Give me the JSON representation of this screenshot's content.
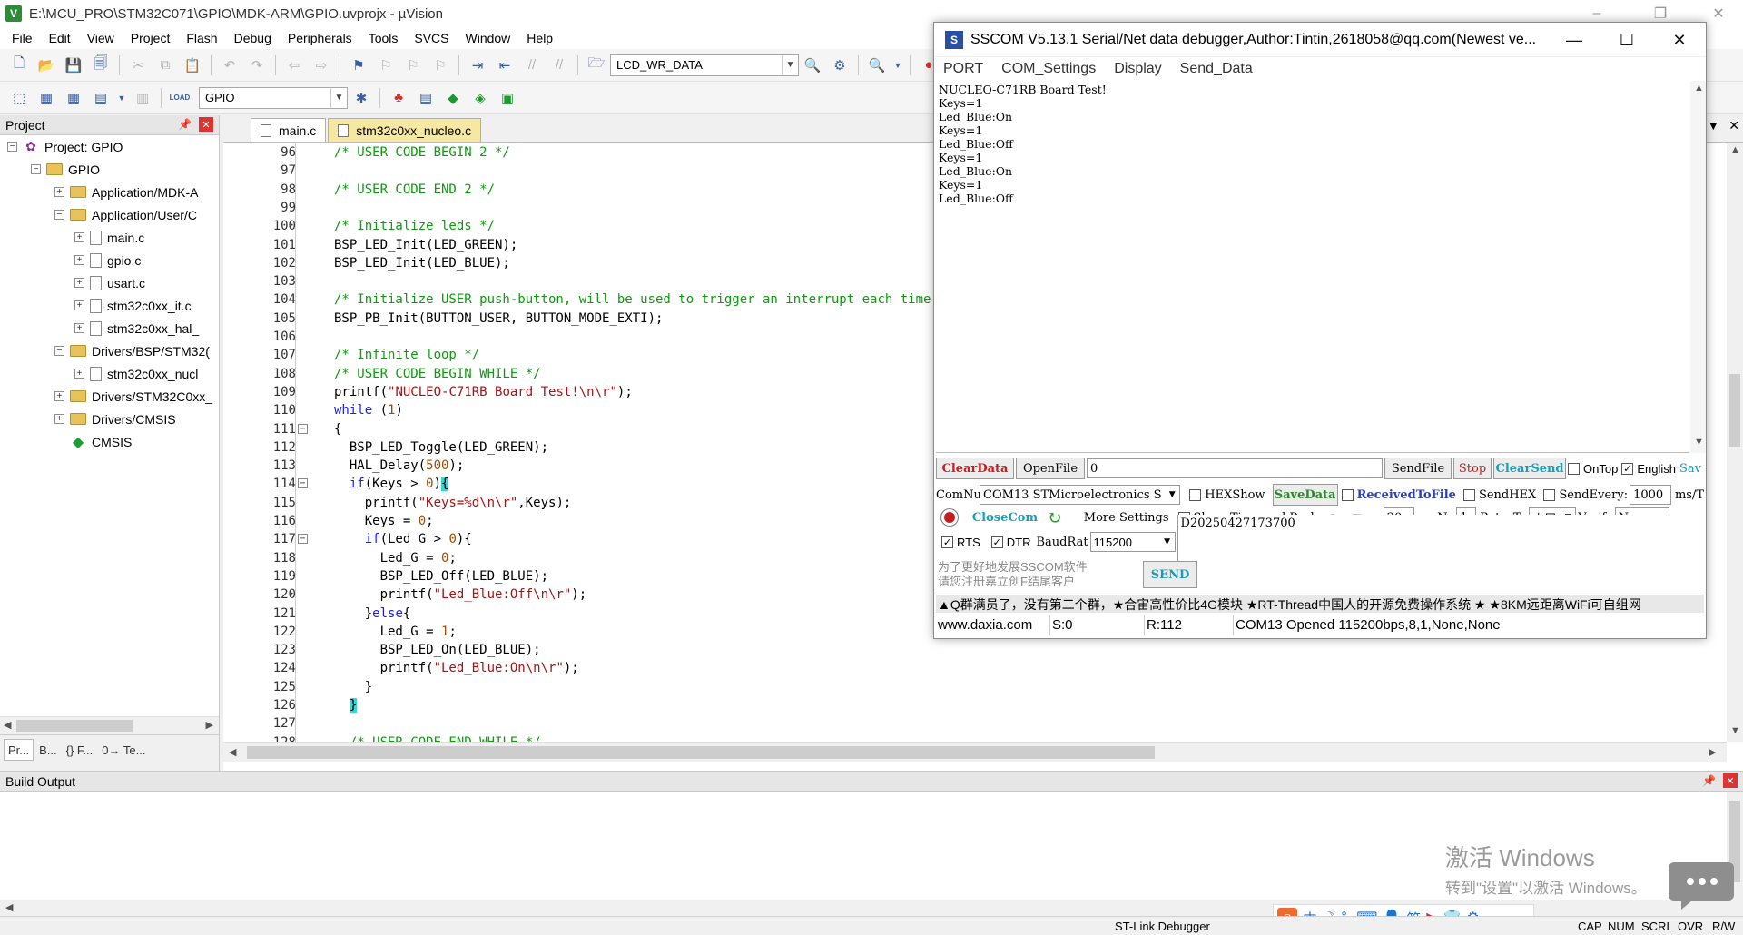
{
  "uvision": {
    "title": "E:\\MCU_PRO\\STM32C071\\GPIO\\MDK-ARM\\GPIO.uvprojx - µVision",
    "menus": [
      "File",
      "Edit",
      "View",
      "Project",
      "Flash",
      "Debug",
      "Peripherals",
      "Tools",
      "SVCS",
      "Window",
      "Help"
    ],
    "toolbar": {
      "target_combo": "LCD_WR_DATA",
      "build_target": "GPIO",
      "load_label": "LOAD"
    },
    "project_panel": {
      "title": "Project",
      "tree": [
        {
          "label": "Project: GPIO",
          "expander": "-",
          "icon": "project"
        },
        {
          "label": "GPIO",
          "expander": "-",
          "icon": "target"
        },
        {
          "label": "Application/MDK-A",
          "expander": "+",
          "icon": "folder"
        },
        {
          "label": "Application/User/C",
          "expander": "-",
          "icon": "folder"
        },
        {
          "label": "main.c",
          "expander": "+",
          "icon": "file"
        },
        {
          "label": "gpio.c",
          "expander": "+",
          "icon": "file"
        },
        {
          "label": "usart.c",
          "expander": "+",
          "icon": "file"
        },
        {
          "label": "stm32c0xx_it.c",
          "expander": "+",
          "icon": "file"
        },
        {
          "label": "stm32c0xx_hal_",
          "expander": "+",
          "icon": "file"
        },
        {
          "label": "Drivers/BSP/STM32(",
          "expander": "-",
          "icon": "folder"
        },
        {
          "label": "stm32c0xx_nucl",
          "expander": "+",
          "icon": "file"
        },
        {
          "label": "Drivers/STM32C0xx_",
          "expander": "+",
          "icon": "folder"
        },
        {
          "label": "Drivers/CMSIS",
          "expander": "+",
          "icon": "folder"
        },
        {
          "label": "CMSIS",
          "expander": "",
          "icon": "cmsis"
        }
      ],
      "bottom_tabs": [
        "Pr...",
        "B...",
        "{} F...",
        "0→ Te..."
      ]
    },
    "editor": {
      "tabs": [
        "main.c",
        "stm32c0xx_nucleo.c"
      ],
      "lines": [
        {
          "n": "96",
          "t": "/* USER CODE BEGIN 2 */",
          "cls": "c-comment",
          "fold": ""
        },
        {
          "n": "97",
          "t": "",
          "cls": "",
          "fold": ""
        },
        {
          "n": "98",
          "t": "/* USER CODE END 2 */",
          "cls": "c-comment",
          "fold": ""
        },
        {
          "n": "99",
          "t": "",
          "cls": "",
          "fold": ""
        },
        {
          "n": "100",
          "t": "/* Initialize leds */",
          "cls": "c-comment",
          "fold": ""
        },
        {
          "n": "101",
          "t": "BSP_LED_Init(LED_GREEN);",
          "cls": "",
          "fold": ""
        },
        {
          "n": "102",
          "t": "BSP_LED_Init(LED_BLUE);",
          "cls": "",
          "fold": ""
        },
        {
          "n": "103",
          "t": "",
          "cls": "",
          "fold": ""
        },
        {
          "n": "104",
          "t": "/* Initialize USER push-button, will be used to trigger an interrupt each time it's pressed.*/",
          "cls": "c-comment",
          "fold": ""
        },
        {
          "n": "105",
          "t": "BSP_PB_Init(BUTTON_USER, BUTTON_MODE_EXTI);",
          "cls": "",
          "fold": ""
        },
        {
          "n": "106",
          "t": "",
          "cls": "",
          "fold": ""
        },
        {
          "n": "107",
          "t": "/* Infinite loop */",
          "cls": "c-comment",
          "fold": ""
        },
        {
          "n": "108",
          "t": "/* USER CODE BEGIN WHILE */",
          "cls": "c-comment",
          "fold": ""
        },
        {
          "n": "109",
          "t": "printf(\"NUCLEO-C71RB Board Test!\\n\\r\");",
          "cls": "mixed-printf",
          "fold": ""
        },
        {
          "n": "110",
          "t": "while (1)",
          "cls": "mixed-while",
          "fold": ""
        },
        {
          "n": "111",
          "t": "{",
          "cls": "",
          "fold": "-"
        },
        {
          "n": "112",
          "t": "  BSP_LED_Toggle(LED_GREEN);",
          "cls": "",
          "fold": ""
        },
        {
          "n": "113",
          "t": "  HAL_Delay(500);",
          "cls": "mixed-delay",
          "fold": ""
        },
        {
          "n": "114",
          "t": "  if(Keys > 0){",
          "cls": "mixed-if1",
          "fold": "-"
        },
        {
          "n": "115",
          "t": "    printf(\"Keys=%d\\n\\r\",Keys);",
          "cls": "mixed-printf2",
          "fold": ""
        },
        {
          "n": "116",
          "t": "    Keys = 0;",
          "cls": "mixed-keys0",
          "fold": ""
        },
        {
          "n": "117",
          "t": "    if(Led_G > 0){",
          "cls": "mixed-if2",
          "fold": "-"
        },
        {
          "n": "118",
          "t": "      Led_G = 0;",
          "cls": "mixed-ledg0",
          "fold": ""
        },
        {
          "n": "119",
          "t": "      BSP_LED_Off(LED_BLUE);",
          "cls": "",
          "fold": ""
        },
        {
          "n": "120",
          "t": "      printf(\"Led_Blue:Off\\n\\r\");",
          "cls": "mixed-printf3",
          "fold": ""
        },
        {
          "n": "121",
          "t": "    }else{",
          "cls": "mixed-else",
          "fold": ""
        },
        {
          "n": "122",
          "t": "      Led_G = 1;",
          "cls": "mixed-ledg1",
          "fold": ""
        },
        {
          "n": "123",
          "t": "      BSP_LED_On(LED_BLUE);",
          "cls": "",
          "fold": ""
        },
        {
          "n": "124",
          "t": "      printf(\"Led_Blue:On\\n\\r\");",
          "cls": "mixed-printf4",
          "fold": ""
        },
        {
          "n": "125",
          "t": "    }",
          "cls": "",
          "fold": ""
        },
        {
          "n": "126",
          "t": "  }",
          "cls": "brace-hl",
          "fold": ""
        },
        {
          "n": "127",
          "t": "",
          "cls": "",
          "fold": ""
        },
        {
          "n": "128",
          "t": "  /* USER CODE END WHILE */",
          "cls": "c-comment",
          "fold": ""
        }
      ]
    },
    "build_output": {
      "title": "Build Output"
    },
    "statusbar": {
      "debugger": "ST-Link Debugger",
      "caps": "CAP",
      "num": "NUM",
      "scrl": "SCRL",
      "ovr": "OVR",
      "rw": "R/W"
    },
    "watermark": {
      "title": "激活 Windows",
      "sub": "转到\"设置\"以激活 Windows。"
    }
  },
  "sscom": {
    "title": "SSCOM V5.13.1 Serial/Net data debugger,Author:Tintin,2618058@qq.com(Newest ve...",
    "menus": [
      "PORT",
      "COM_Settings",
      "Display",
      "Send_Data"
    ],
    "received": [
      "NUCLEO-C71RB Board Test!",
      "Keys=1",
      "Led_Blue:On",
      "Keys=1",
      "Led_Blue:Off",
      "Keys=1",
      "Led_Blue:On",
      "Keys=1",
      "Led_Blue:Off"
    ],
    "row1": {
      "clear_data": "ClearData",
      "open_file": "OpenFile",
      "file_path": "0",
      "send_file": "SendFile",
      "stop": "Stop",
      "clear_send": "ClearSend",
      "ontop": "OnTop",
      "english": "English",
      "save": "Sav"
    },
    "row2": {
      "comnum_label": "ComNum",
      "com_port": "COM13 STMicroelectronics S",
      "hexshow": "HEXShow",
      "save_data": "SaveData",
      "received_to_file": "ReceivedToFile",
      "send_hex": "SendHEX",
      "send_every": "SendEvery:",
      "interval": "1000",
      "interval_unit": "ms/T"
    },
    "row3": {
      "close_com": "CloseCom",
      "more_settings": "More Settings",
      "show_time": "Show Time and Packe",
      "overtime_label": "OverTime:",
      "overtime": "20",
      "ms_label": "ms",
      "no_label": "No",
      "no_value": "1",
      "bytes_to_label": "BytesTo",
      "bytes_to_value": "末尾",
      "verify_label": "Verify",
      "verify_value": "None"
    },
    "row4": {
      "rts": "RTS",
      "dtr": "DTR",
      "baud_label": "BaudRat",
      "baud": "115200",
      "send_text": "D20250427173700"
    },
    "promo": [
      "为了更好地发展SSCOM软件",
      "请您注册嘉立创F结尾客户"
    ],
    "send_button": "SEND",
    "marquee": "▲Q群满员了，没有第二个群，★合宙高性价比4G模块 ★RT-Thread中国人的开源免费操作系统 ★ ★8KM远距离WiFi可自组网",
    "status": {
      "site": "www.daxia.com",
      "sent": "S:0",
      "received": "R:112",
      "port_status": "COM13 Opened  115200bps,8,1,None,None"
    }
  }
}
